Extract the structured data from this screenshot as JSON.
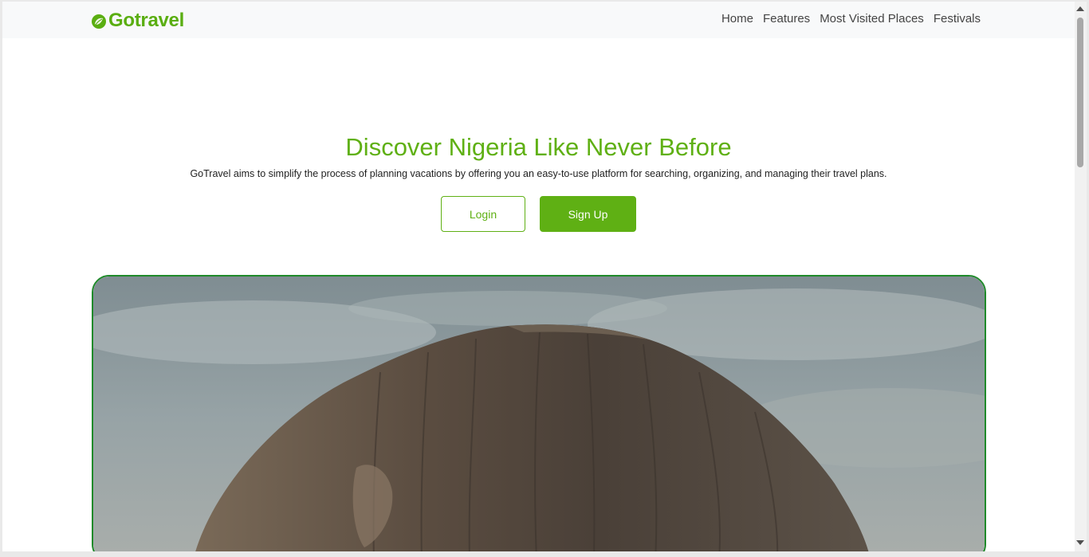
{
  "brand": {
    "name": "Gotravel",
    "icon": "gotravel-logo-icon",
    "color": "#5aae11"
  },
  "nav": {
    "items": [
      {
        "label": "Home"
      },
      {
        "label": "Features"
      },
      {
        "label": "Most Visited Places"
      },
      {
        "label": "Festivals"
      }
    ]
  },
  "hero": {
    "title": "Discover Nigeria Like Never Before",
    "subtitle": "GoTravel aims to simplify the process of planning vacations by offering you an easy-to-use platform for searching, organizing, and managing their travel plans.",
    "login_label": "Login",
    "signup_label": "Sign Up",
    "accent_color": "#5fb014",
    "image_border_color": "#1f8a2a"
  }
}
